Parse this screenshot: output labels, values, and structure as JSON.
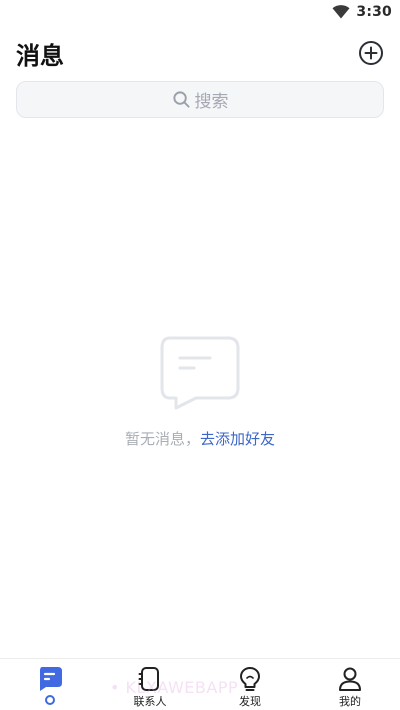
{
  "status_bar": {
    "time": "3:30",
    "wifi_icon": "wifi-icon"
  },
  "header": {
    "title": "消息",
    "add_icon": "plus-circle-icon"
  },
  "search": {
    "placeholder": "搜索",
    "icon": "search-icon"
  },
  "empty_state": {
    "icon": "message-bubble-icon",
    "text": "暂无消息，",
    "link": "去添加好友"
  },
  "tab_bar": {
    "active_color": "#4169e1",
    "tabs": [
      {
        "label": "",
        "icon": "message-icon",
        "active": true
      },
      {
        "label": "联系人",
        "icon": "contacts-icon",
        "active": false
      },
      {
        "label": "发现",
        "icon": "bulb-icon",
        "active": false
      },
      {
        "label": "我的",
        "icon": "profile-icon",
        "active": false
      }
    ]
  },
  "watermark": "• KLXAWEBAPP"
}
